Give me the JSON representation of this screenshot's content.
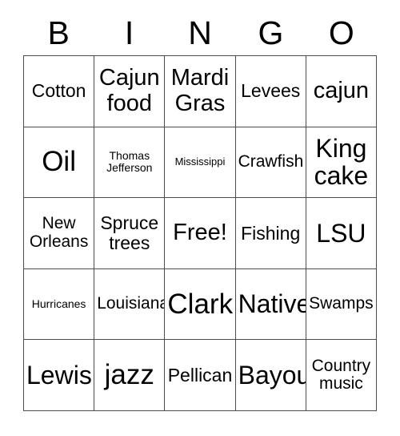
{
  "card": {
    "header_letters": [
      "B",
      "I",
      "N",
      "G",
      "O"
    ],
    "rows": [
      [
        {
          "text": "Cotton",
          "size": "lg"
        },
        {
          "text": "Cajun\nfood",
          "size": "xl"
        },
        {
          "text": "Mardi\nGras",
          "size": "xl"
        },
        {
          "text": "Levees",
          "size": "lg"
        },
        {
          "text": "cajun",
          "size": "xl"
        }
      ],
      [
        {
          "text": "Oil",
          "size": "huge"
        },
        {
          "text": "Thomas\nJefferson",
          "size": "sm"
        },
        {
          "text": "Mississippi",
          "size": "xs"
        },
        {
          "text": "Crawfish",
          "size": "md"
        },
        {
          "text": "King\ncake",
          "size": "xxl"
        }
      ],
      [
        {
          "text": "New\nOrleans",
          "size": "md"
        },
        {
          "text": "Spruce\ntrees",
          "size": "lg"
        },
        {
          "text": "Free!",
          "size": "xl"
        },
        {
          "text": "Fishing",
          "size": "lg"
        },
        {
          "text": "LSU",
          "size": "xxl"
        }
      ],
      [
        {
          "text": "Hurricanes",
          "size": "sm"
        },
        {
          "text": "Louisiana",
          "size": "md"
        },
        {
          "text": "Clark",
          "size": "huge"
        },
        {
          "text": "Native",
          "size": "xxl"
        },
        {
          "text": "Swamps",
          "size": "md"
        }
      ],
      [
        {
          "text": "Lewis",
          "size": "xxl"
        },
        {
          "text": "jazz",
          "size": "huge"
        },
        {
          "text": "Pellican",
          "size": "lg"
        },
        {
          "text": "Bayou",
          "size": "xxl"
        },
        {
          "text": "Country\nmusic",
          "size": "md"
        }
      ]
    ]
  },
  "colors": {
    "background": "#ffffff",
    "text": "#000000",
    "grid_line": "#4d4d4d"
  }
}
